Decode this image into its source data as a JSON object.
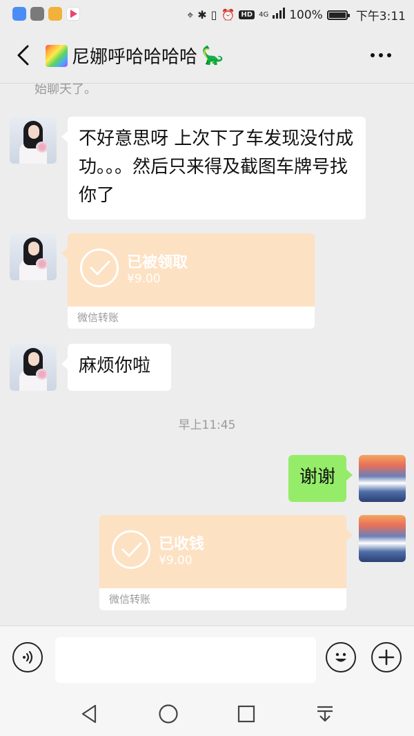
{
  "status_bar": {
    "network": "4G",
    "battery_percent": "100%",
    "time": "下午3:11",
    "app_icon_colors": [
      "#4a8df6",
      "#7a7a7a",
      "#f0b23a",
      "#e8456f"
    ]
  },
  "header": {
    "title": "尼娜呼哈哈哈哈",
    "icons": [
      "back-arrow-icon",
      "rainbow-emoji",
      "dinosaur-emoji",
      "more-dots-icon"
    ]
  },
  "chat": {
    "partial_system_text": "始聊天了。",
    "messages": [
      {
        "side": "left",
        "type": "text",
        "text": "不好意思呀 上次下了车发现没付成功。。。然后只来得及截图车牌号找你了"
      },
      {
        "side": "left",
        "type": "transfer",
        "status": "已被领取",
        "amount": "¥9.00",
        "label": "微信转账"
      },
      {
        "side": "left",
        "type": "text",
        "text": "麻烦你啦"
      },
      {
        "side": "center",
        "type": "time",
        "text": "早上11:45"
      },
      {
        "side": "right",
        "type": "text",
        "text": "谢谢"
      },
      {
        "side": "right",
        "type": "transfer",
        "status": "已收钱",
        "amount": "¥9.00",
        "label": "微信转账"
      }
    ]
  },
  "input_bar": {
    "placeholder": "",
    "icons": [
      "voice-icon",
      "emoji-icon",
      "plus-icon"
    ]
  },
  "system_nav": {
    "icons": [
      "nav-back-icon",
      "nav-home-icon",
      "nav-recents-icon",
      "nav-notification-icon"
    ]
  },
  "colors": {
    "background": "#ededed",
    "bubble_incoming": "#ffffff",
    "bubble_outgoing": "#95ec69",
    "transfer_card": "#fde1c3"
  }
}
